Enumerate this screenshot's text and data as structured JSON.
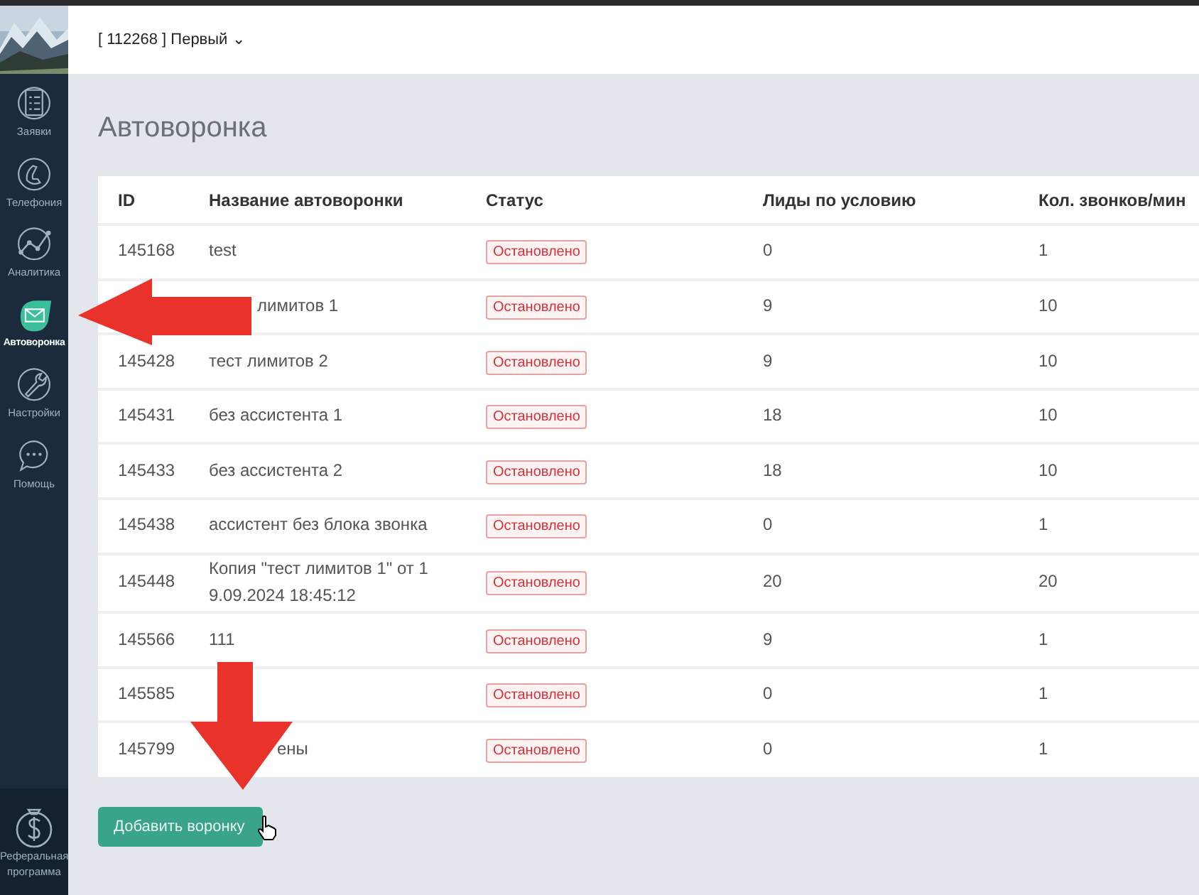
{
  "header": {
    "account": "[ 112268 ] Первый",
    "caret": "⌄"
  },
  "sidebar": {
    "items": [
      {
        "label": "Заявки",
        "selected": false
      },
      {
        "label": "Телефония",
        "selected": false
      },
      {
        "label": "Аналитика",
        "selected": false
      },
      {
        "label": "Автоворонка",
        "selected": true
      },
      {
        "label": "Настройки",
        "selected": false
      },
      {
        "label": "Помощь",
        "selected": false
      }
    ],
    "footer": {
      "label": "Реферальная программа"
    }
  },
  "page_title": "Автоворонка",
  "table": {
    "columns": [
      "ID",
      "Название автоворонки",
      "Статус",
      "Лиды по условию",
      "Кол. звонков/мин"
    ],
    "rows": [
      {
        "id": "145168",
        "name": "test",
        "status": "Остановлено",
        "leads": "0",
        "calls": "1"
      },
      {
        "name": "лимитов 1",
        "name_partial": true,
        "status": "Остановлено",
        "leads": "9",
        "calls": "10"
      },
      {
        "id": "145428",
        "name": "тест лимитов 2",
        "status": "Остановлено",
        "leads": "9",
        "calls": "10"
      },
      {
        "id": "145431",
        "name": "без ассистента 1",
        "status": "Остановлено",
        "leads": "18",
        "calls": "10"
      },
      {
        "id": "145433",
        "name": "без ассистента 2",
        "status": "Остановлено",
        "leads": "18",
        "calls": "10"
      },
      {
        "id": "145438",
        "name": "ассистент без блока звонка",
        "status": "Остановлено",
        "leads": "0",
        "calls": "1"
      },
      {
        "id": "145448",
        "name": "Копия \"тест лимитов 1\" от 1 9.09.2024 18:45:12",
        "status": "Остановлено",
        "leads": "20",
        "calls": "20"
      },
      {
        "id": "145566",
        "name": "111",
        "status": "Остановлено",
        "leads": "9",
        "calls": "1"
      },
      {
        "id": "145585",
        "status": "Остановлено",
        "leads": "0",
        "calls": "1"
      },
      {
        "id": "145799",
        "name": "ены",
        "name_partial": true,
        "status": "Остановлено",
        "leads": "0",
        "calls": "1"
      }
    ]
  },
  "add_button": "Добавить воронку"
}
